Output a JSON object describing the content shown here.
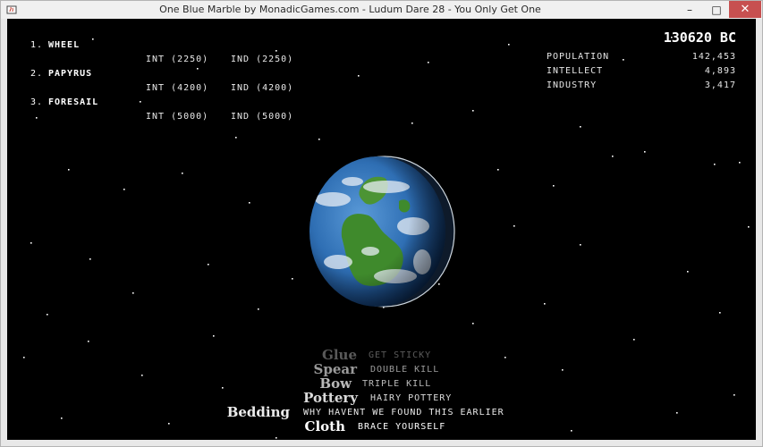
{
  "window": {
    "title": "One Blue Marble by MonadicGames.com - Ludum Dare 28 - You Only Get One",
    "minimize_glyph": "–",
    "maximize_glyph": "□",
    "close_glyph": "✕"
  },
  "techs": [
    {
      "number": "1.",
      "name": "WHEEL",
      "int_cost": "INT (2250)",
      "ind_cost": "IND (2250)"
    },
    {
      "number": "2.",
      "name": "PAPYRUS",
      "int_cost": "INT (4200)",
      "ind_cost": "IND (4200)"
    },
    {
      "number": "3.",
      "name": "FORESAIL",
      "int_cost": "INT (5000)",
      "ind_cost": "IND (5000)"
    }
  ],
  "year": "130620 BC",
  "stats": [
    {
      "label": "POPULATION",
      "value": "142,453"
    },
    {
      "label": "INTELLECT",
      "value": "4,893"
    },
    {
      "label": "INDUSTRY",
      "value": "3,417"
    }
  ],
  "history": [
    {
      "name": "Glue",
      "desc": "GET STICKY",
      "opacity": 0.35
    },
    {
      "name": "Spear",
      "desc": "DOUBLE KILL",
      "opacity": 0.6
    },
    {
      "name": "Bow",
      "desc": "TRIPLE KILL",
      "opacity": 0.72
    },
    {
      "name": "Pottery",
      "desc": "HAIRY POTTERY",
      "opacity": 0.85
    },
    {
      "name": "Bedding",
      "desc": "WHY HAVENT WE FOUND THIS EARLIER",
      "opacity": 0.92
    },
    {
      "name": "Cloth",
      "desc": "BRACE YOURSELF",
      "opacity": 1.0
    }
  ],
  "colors": {
    "space": "#000000",
    "ocean": "#2f6fb4",
    "land": "#3f8a2c",
    "close_button": "#c75050"
  },
  "icons": {
    "app": "java-app-icon"
  }
}
